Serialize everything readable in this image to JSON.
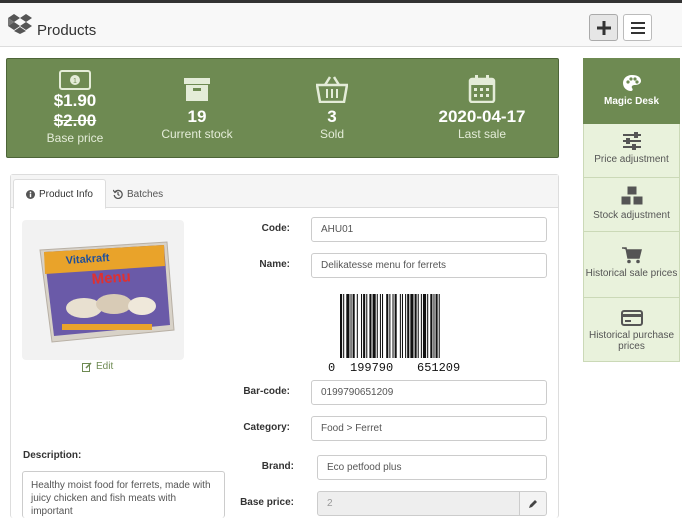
{
  "app": {
    "title": "Products",
    "logo_icon": "dropbox-box-icon"
  },
  "toolbar": {
    "add_icon": "plus-icon",
    "menu_icon": "hamburger-menu-icon"
  },
  "summary": {
    "price": {
      "current": "$1.90",
      "old": "$2.00",
      "label": "Base price",
      "icon": "banknote-icon"
    },
    "stock": {
      "value": "19",
      "label": "Current stock",
      "icon": "archive-box-icon"
    },
    "sold": {
      "value": "3",
      "label": "Sold",
      "icon": "basket-icon"
    },
    "last_sale": {
      "value": "2020-04-17",
      "label": "Last sale",
      "icon": "calendar-icon"
    },
    "bg_color": "#6e8a52"
  },
  "sidebar": {
    "items": [
      {
        "label": "Magic Desk",
        "icon": "palette-icon",
        "active": true
      },
      {
        "label": "Price adjustment",
        "icon": "sliders-icon"
      },
      {
        "label": "Stock adjustment",
        "icon": "cubes-icon"
      },
      {
        "label": "Historical sale prices",
        "icon": "cart-icon"
      },
      {
        "label": "Historical purchase prices",
        "icon": "credit-card-icon"
      }
    ]
  },
  "tabs": [
    {
      "label": "Product Info",
      "icon": "info-icon"
    },
    {
      "label": "Batches",
      "icon": "history-icon"
    }
  ],
  "product": {
    "edit_label": "Edit",
    "code_label": "Code:",
    "code": "AHU01",
    "name_label": "Name:",
    "name": "Delikatesse menu for ferrets",
    "barcode_digits": {
      "first": "0",
      "left": "199790",
      "right": "651209"
    },
    "barcode_label": "Bar-code:",
    "barcode": "0199790651209",
    "category_label": "Category:",
    "category": "Food > Ferret",
    "brand_label": "Brand:",
    "brand": "Eco petfood plus",
    "base_price_label": "Base price:",
    "base_price": "2",
    "description_label": "Description:",
    "description": "Healthy moist food for ferrets, made with juicy chicken and fish meats with important",
    "image_text": {
      "brand": "Vitakraft",
      "line": "Menu"
    }
  }
}
